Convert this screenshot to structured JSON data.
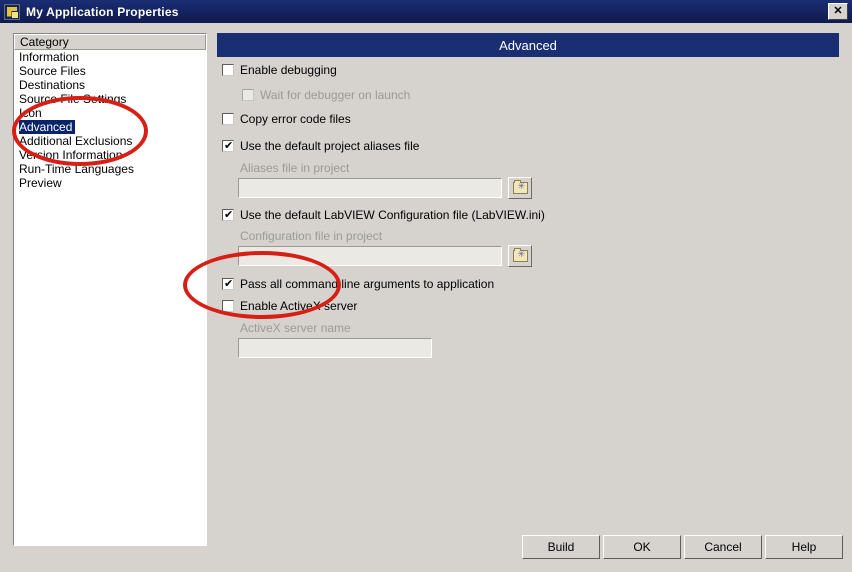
{
  "window": {
    "title": "My Application Properties",
    "icon": "labview-app-icon",
    "close_label": "✕",
    "titlebar_color": "#13215c"
  },
  "sidebar": {
    "header": "Category",
    "selected": "Advanced",
    "items": [
      {
        "label": "Information"
      },
      {
        "label": "Source Files"
      },
      {
        "label": "Destinations"
      },
      {
        "label": "Source File Settings"
      },
      {
        "label": "Icon"
      },
      {
        "label": "Advanced"
      },
      {
        "label": "Additional Exclusions"
      },
      {
        "label": "Version Information"
      },
      {
        "label": "Run-Time Languages"
      },
      {
        "label": "Preview"
      }
    ]
  },
  "panel": {
    "header": "Advanced",
    "header_color": "#1a2f73",
    "checkboxes": {
      "enable_debugging": {
        "label": "Enable debugging",
        "checked": false,
        "enabled": true
      },
      "wait_for_debugger": {
        "label": "Wait for debugger on launch",
        "checked": false,
        "enabled": false
      },
      "copy_error_code_files": {
        "label": "Copy error code files",
        "checked": false,
        "enabled": true
      },
      "use_default_aliases": {
        "label": "Use the default project aliases file",
        "checked": true,
        "enabled": true
      },
      "use_default_config": {
        "label": "Use the default LabVIEW Configuration file (LabVIEW.ini)",
        "checked": true,
        "enabled": true
      },
      "pass_command_line_args": {
        "label": "Pass all command line arguments to application",
        "checked": true,
        "enabled": true
      },
      "enable_activex": {
        "label": "Enable ActiveX server",
        "checked": false,
        "enabled": true
      }
    },
    "fields": {
      "aliases_file": {
        "label": "Aliases file in project",
        "value": "",
        "placeholder": "",
        "browse_icon": "folder-icon"
      },
      "config_file": {
        "label": "Configuration file in project",
        "value": "",
        "placeholder": "",
        "browse_icon": "folder-icon"
      },
      "activex_server_name": {
        "label": "ActiveX server name",
        "value": "",
        "placeholder": ""
      }
    }
  },
  "buttons": {
    "build": "Build",
    "ok": "OK",
    "cancel": "Cancel",
    "help": "Help"
  },
  "annotations": {
    "color": "#d81f15",
    "ellipses": [
      {
        "name": "sidebar-advanced-highlight"
      },
      {
        "name": "command-line-args-highlight"
      }
    ]
  }
}
